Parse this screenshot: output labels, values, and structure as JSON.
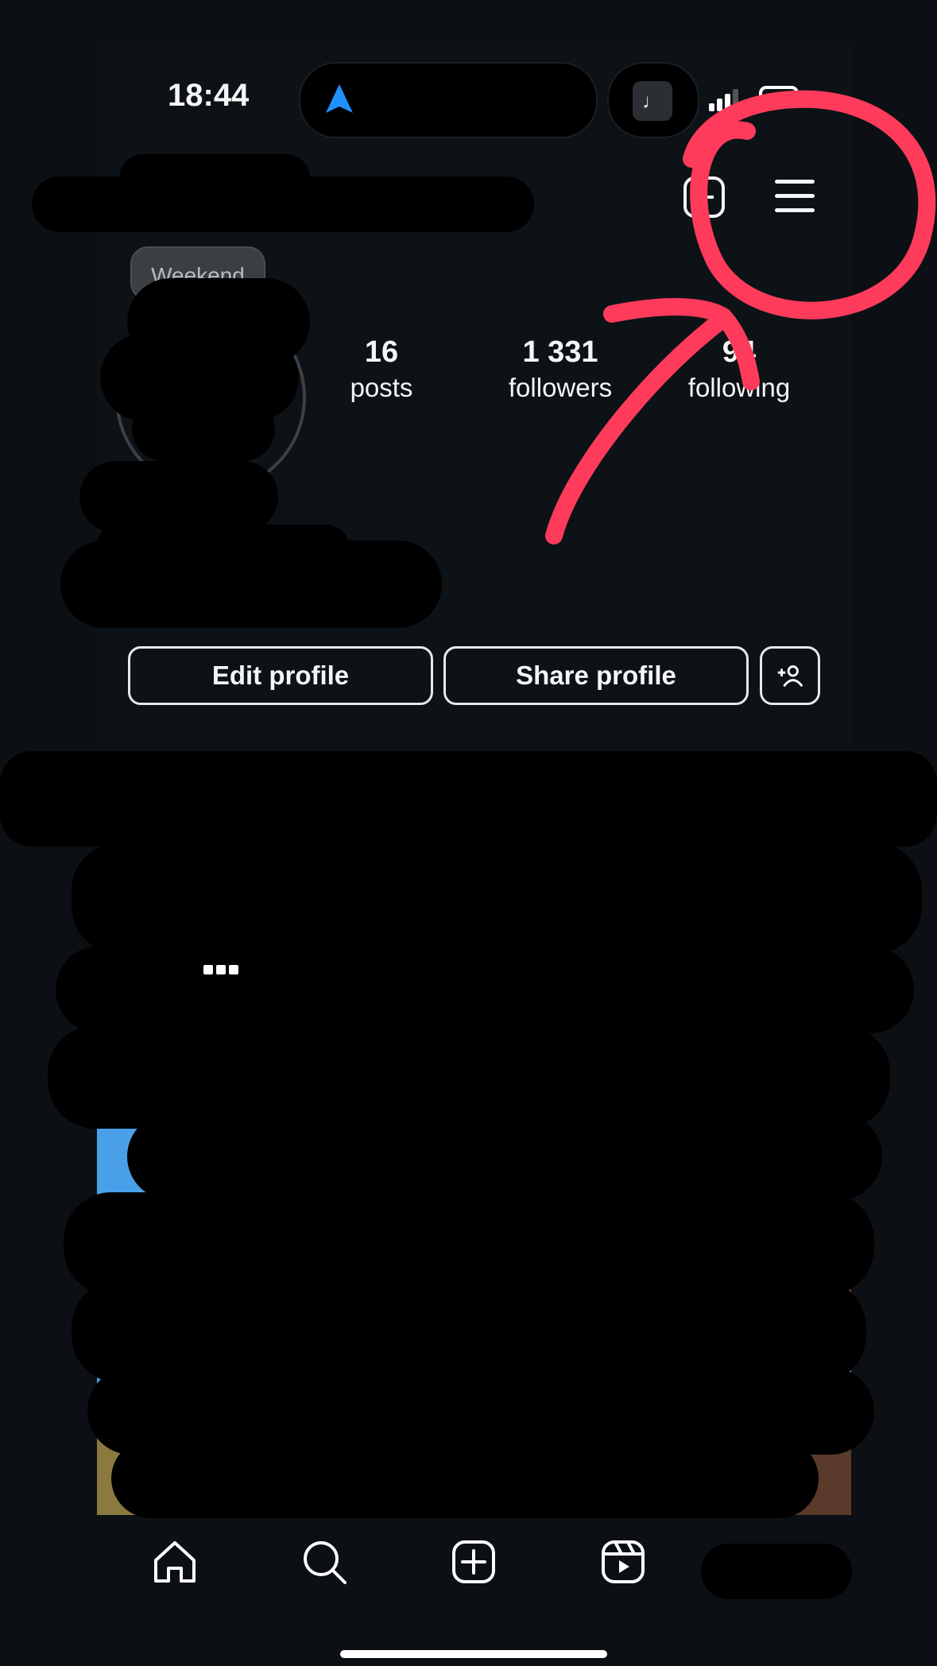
{
  "status_bar": {
    "time": "18:44",
    "music_glyph": "♩",
    "icons": [
      "location-arrow-icon",
      "signal-icon",
      "battery-icon"
    ]
  },
  "header": {
    "icons": [
      "add-post-icon",
      "menu-icon"
    ]
  },
  "profile": {
    "note": "Weekend",
    "stats": [
      {
        "value": "16",
        "label": "posts"
      },
      {
        "value": "1 331",
        "label": "followers"
      },
      {
        "value": "94",
        "label": "following"
      }
    ]
  },
  "actions": {
    "edit_label": "Edit profile",
    "share_label": "Share profile",
    "add_person_icon": "add-person-icon"
  },
  "tab_bar": {
    "icons": [
      "home-icon",
      "search-icon",
      "create-icon",
      "reels-icon",
      "profile-icon"
    ]
  },
  "colors": {
    "background": "#0c1014",
    "annotation": "#ff3b5c",
    "accent_blue": "#1e90ff"
  }
}
